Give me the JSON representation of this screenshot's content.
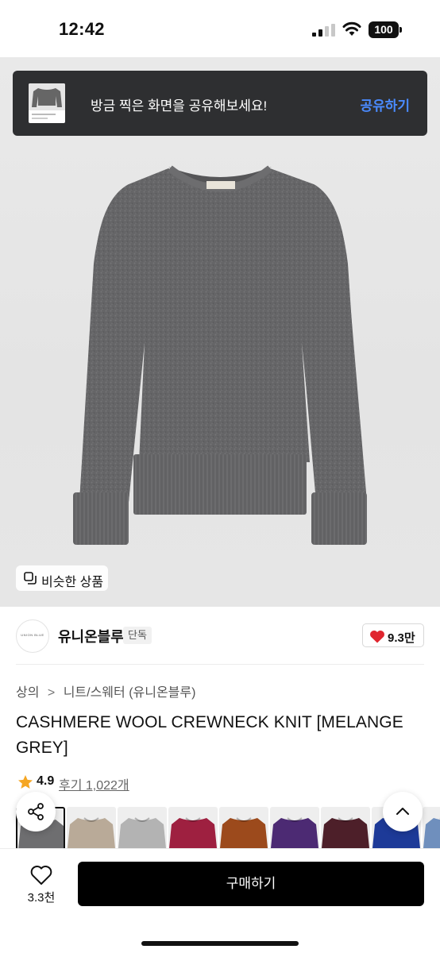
{
  "status_bar": {
    "time": "12:42",
    "battery": "100"
  },
  "share_toast": {
    "message": "방금 찍은 화면을 공유해보세요!",
    "action": "공유하기"
  },
  "hero": {
    "similar_label": "비슷한 상품"
  },
  "brand": {
    "logo_text": "UNION BLUE",
    "name": "유니온블루",
    "badge": "단독",
    "likes": "9.3만"
  },
  "breadcrumb": {
    "level1": "상의",
    "separator": ">",
    "level2": "니트/스웨터 (유니온블루)"
  },
  "product": {
    "title": "CASHMERE WOOL CREWNECK KNIT [MELANGE GREY]",
    "rating": "4.9",
    "reviews": "후기 1,022개"
  },
  "swatches": [
    {
      "color": "#6e6e70",
      "selected": true
    },
    {
      "color": "#b9aa98"
    },
    {
      "color": "#b3b3b3"
    },
    {
      "color": "#9e2040"
    },
    {
      "color": "#9c4a1c"
    },
    {
      "color": "#4c2a73"
    },
    {
      "color": "#4d1f29"
    },
    {
      "color": "#1d3a98"
    },
    {
      "color": "#6f8fbd"
    }
  ],
  "bottom_bar": {
    "wish_count": "3.3천",
    "buy_label": "구매하기"
  },
  "colors": {
    "toast_bg": "#2e2f31",
    "toast_action": "#4a8bff",
    "heart": "#e0262f",
    "star": "#f5a623",
    "buy_bg": "#000000"
  },
  "icons": [
    "signal-icon",
    "wifi-icon",
    "battery-icon",
    "similar-icon",
    "heart-icon",
    "star-icon",
    "share-icon",
    "chevron-up-icon",
    "wishlist-heart-icon"
  ]
}
